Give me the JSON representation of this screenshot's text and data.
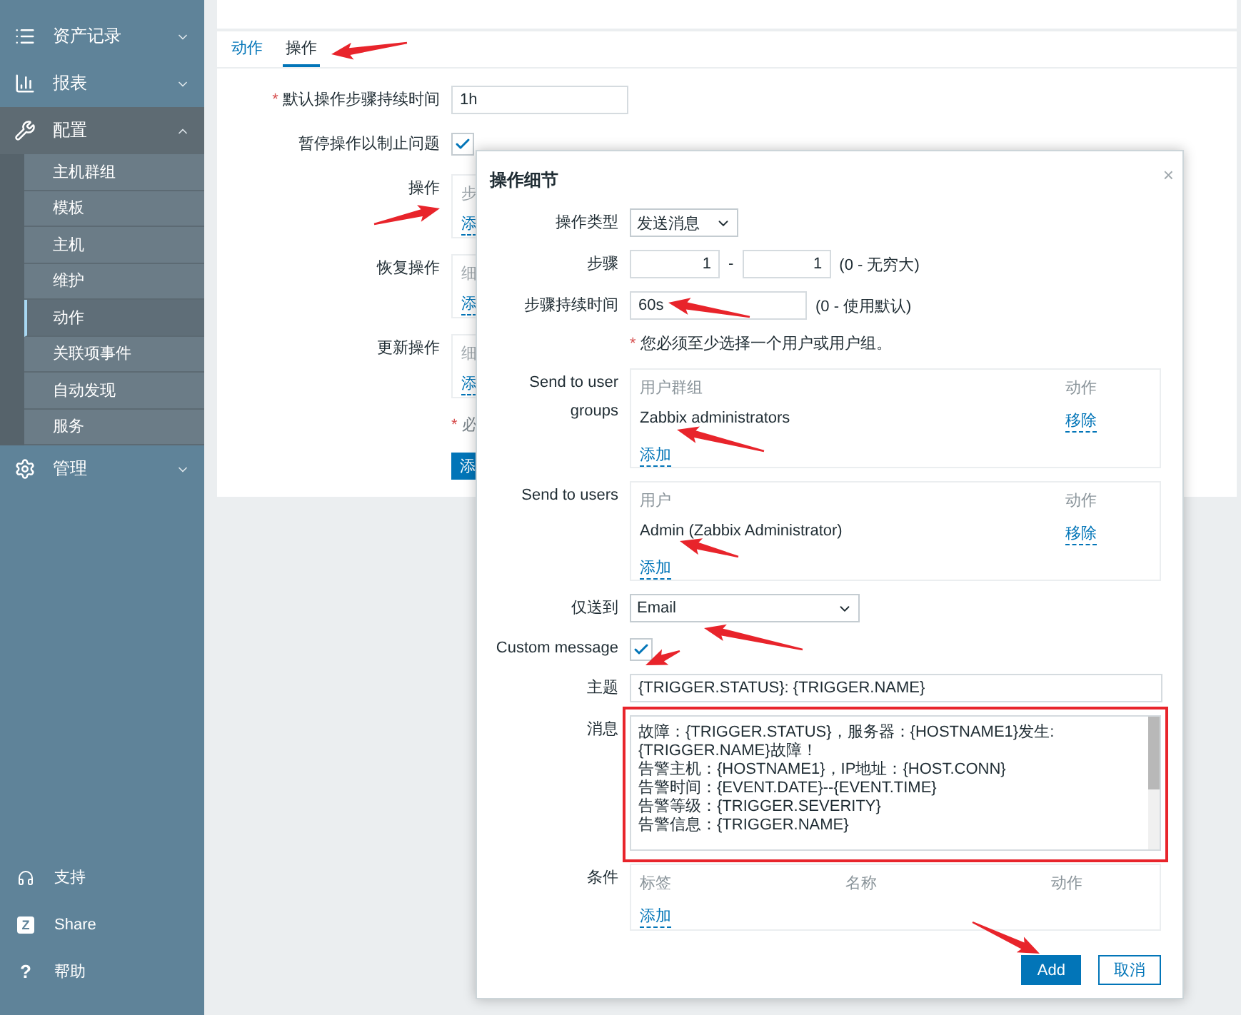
{
  "sidebar": {
    "sections": [
      {
        "label": "资产记录",
        "kind": "list",
        "expanded": false
      },
      {
        "label": "报表",
        "kind": "chart",
        "expanded": false
      },
      {
        "label": "配置",
        "kind": "wrench",
        "expanded": true,
        "children": [
          {
            "label": "主机群组",
            "selected": false
          },
          {
            "label": "模板",
            "selected": false
          },
          {
            "label": "主机",
            "selected": false
          },
          {
            "label": "维护",
            "selected": false
          },
          {
            "label": "动作",
            "selected": true
          },
          {
            "label": "关联项事件",
            "selected": false
          },
          {
            "label": "自动发现",
            "selected": false
          },
          {
            "label": "服务",
            "selected": false
          }
        ]
      },
      {
        "label": "管理",
        "kind": "gear",
        "expanded": false
      }
    ],
    "footer": [
      {
        "label": "支持",
        "kind": "headset"
      },
      {
        "label": "Share",
        "kind": "share",
        "glyph": "Z"
      },
      {
        "label": "帮助",
        "kind": "help",
        "glyph": "?"
      }
    ]
  },
  "tabs": [
    {
      "label": "动作",
      "selected": false
    },
    {
      "label": "操作",
      "selected": true
    }
  ],
  "form": {
    "rows": [
      {
        "kind": "input",
        "mark": "*",
        "label": "默认操作步骤持续时间",
        "value": "1h"
      },
      {
        "kind": "checkbox",
        "label": "暂停操作以制止问题",
        "checked": true
      },
      {
        "kind": "list",
        "label": "操作",
        "lines": [
          {
            "kind": "header",
            "text": "步"
          },
          {
            "kind": "link",
            "text": "添"
          }
        ]
      },
      {
        "kind": "list",
        "label": "恢复操作",
        "lines": [
          {
            "kind": "header",
            "text": "细"
          },
          {
            "kind": "link",
            "text": "添"
          }
        ]
      },
      {
        "kind": "list",
        "label": "更新操作",
        "lines": [
          {
            "kind": "header",
            "text": "细"
          },
          {
            "kind": "link",
            "text": "添"
          }
        ]
      }
    ],
    "required_note": {
      "mark": "*",
      "text": "必"
    },
    "button": "添"
  },
  "dialog": {
    "title": "操作细节",
    "close": "×",
    "operation_type": {
      "label": "操作类型",
      "value": "发送消息"
    },
    "steps": {
      "label": "步骤",
      "from": "1",
      "separator": "-",
      "to": "1",
      "hint": "(0 - 无穷大)"
    },
    "step_duration": {
      "label": "步骤持续时间",
      "value": "60s",
      "hint": "(0 - 使用默认)"
    },
    "notice": {
      "mark": "*",
      "text": "您必须至少选择一个用户或用户组。"
    },
    "user_groups": {
      "label": "Send to user groups",
      "columns": [
        "用户群组",
        "动作"
      ],
      "rows": [
        {
          "name": "Zabbix administrators",
          "action": "移除"
        }
      ],
      "add": "添加"
    },
    "users": {
      "label": "Send to users",
      "columns": [
        "用户",
        "动作"
      ],
      "rows": [
        {
          "name": "Admin (Zabbix Administrator)",
          "action": "移除"
        }
      ],
      "add": "添加"
    },
    "send_only_to": {
      "label": "仅送到",
      "value": "Email"
    },
    "custom_message": {
      "label": "Custom message",
      "checked": true
    },
    "subject": {
      "label": "主题",
      "value": "{TRIGGER.STATUS}: {TRIGGER.NAME}"
    },
    "message": {
      "label": "消息",
      "lines": [
        "故障：{TRIGGER.STATUS}，服务器：{HOSTNAME1}发生:{TRIGGER.NAME}故障！",
        "告警主机：{HOSTNAME1}，IP地址：{HOST.CONN}",
        "告警时间：{EVENT.DATE}--{EVENT.TIME}",
        "告警等级：{TRIGGER.SEVERITY}",
        "告警信息：{TRIGGER.NAME}"
      ]
    },
    "conditions": {
      "label": "条件",
      "columns": [
        "标签",
        "名称",
        "动作"
      ],
      "add": "添加"
    },
    "buttons": [
      {
        "label": "Add",
        "kind": "primary"
      },
      {
        "label": "取消",
        "kind": "secondary"
      }
    ]
  }
}
